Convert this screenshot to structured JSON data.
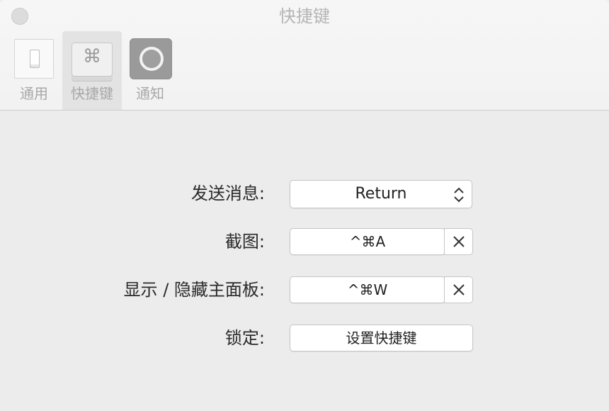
{
  "window": {
    "title": "快捷键"
  },
  "tabs": [
    {
      "label": "通用",
      "icon": "switch-icon"
    },
    {
      "label": "快捷键",
      "icon": "command-key-icon",
      "symbol": "⌘"
    },
    {
      "label": "通知",
      "icon": "notification-icon"
    }
  ],
  "settings": {
    "send_message": {
      "label": "发送消息:",
      "value": "Return"
    },
    "screenshot": {
      "label": "截图:",
      "value": "^⌘A"
    },
    "toggle_panel": {
      "label": "显示 / 隐藏主面板:",
      "value": "^⌘W"
    },
    "lock": {
      "label": "锁定:",
      "button": "设置快捷键"
    }
  }
}
